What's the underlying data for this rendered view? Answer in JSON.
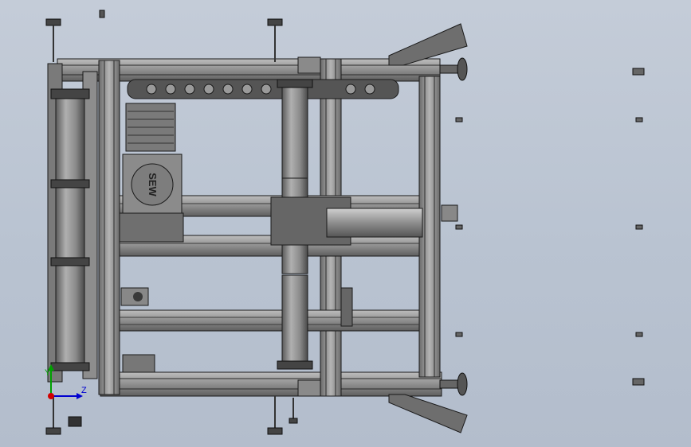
{
  "viewport": {
    "background_top": "#c4ccd8",
    "background_bottom": "#b3bdcc",
    "model_fill": "#9a9a9a",
    "model_dark": "#3a3a3a",
    "model_edge": "#1a1a1a",
    "roller_fill": "#8c8c8c",
    "plate_fill": "#6e6e6e"
  },
  "motor": {
    "brand_text": "SEW"
  },
  "triad": {
    "y_label": "Y",
    "z_label": "Z",
    "x_color": "#d00000",
    "y_color": "#00a000",
    "z_color": "#0000d0"
  }
}
